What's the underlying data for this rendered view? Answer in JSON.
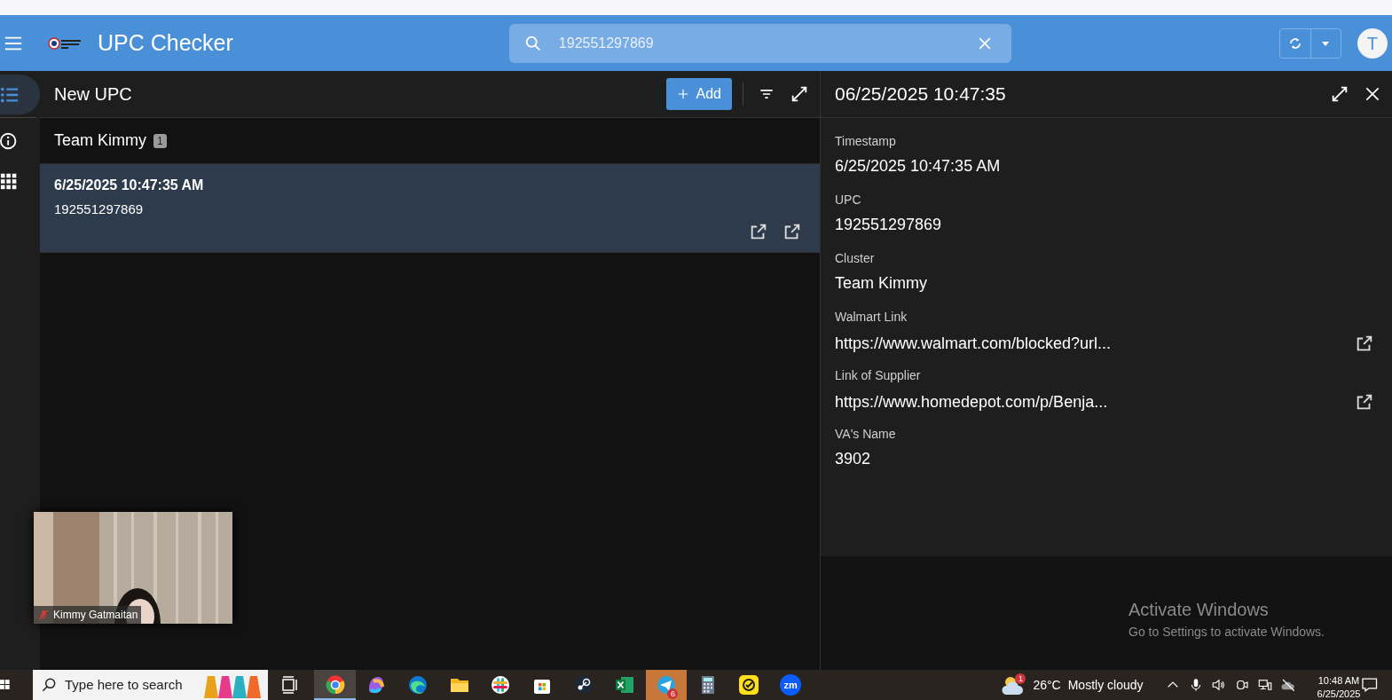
{
  "header": {
    "title": "UPC Checker",
    "search": {
      "value": "192551297869"
    },
    "avatar": "T"
  },
  "rail": [
    {
      "kind": "list",
      "selected": true
    },
    {
      "kind": "info",
      "selected": false
    },
    {
      "kind": "apps",
      "selected": false
    }
  ],
  "list_panel": {
    "title": "New UPC",
    "add_button": "Add",
    "groups": [
      {
        "name": "Team Kimmy",
        "count": "1",
        "items": [
          {
            "title": "6/25/2025 10:47:35 AM",
            "subtitle": "192551297869",
            "selected": true
          }
        ]
      }
    ]
  },
  "detail": {
    "title": "06/25/2025 10:47:35",
    "fields": [
      {
        "label": "Timestamp",
        "value": "6/25/2025 10:47:35 AM",
        "kind": "text"
      },
      {
        "label": "UPC",
        "value": "192551297869",
        "kind": "text"
      },
      {
        "label": "Cluster",
        "value": "Team Kimmy",
        "kind": "text"
      },
      {
        "label": "Walmart Link",
        "value": "https://www.walmart.com/blocked?url...",
        "kind": "link"
      },
      {
        "label": "Link of Supplier",
        "value": "https://www.homedepot.com/p/Benja...",
        "kind": "link"
      },
      {
        "label": "VA's Name",
        "value": "3902",
        "kind": "text"
      }
    ]
  },
  "video": {
    "name": "Kimmy Gatmaitan",
    "muted": true
  },
  "os_notice": {
    "title": "Activate Windows",
    "text": "Go to Settings to activate Windows."
  },
  "taskbar": {
    "search_placeholder": "Type here to search",
    "apps": [
      {
        "kind": "taskview",
        "selected": false,
        "flashing": false
      },
      {
        "kind": "browser",
        "selected": true,
        "flashing": false
      },
      {
        "kind": "swirl",
        "selected": false,
        "flashing": false
      },
      {
        "kind": "wave",
        "selected": false,
        "flashing": false
      },
      {
        "kind": "folder",
        "selected": false,
        "flashing": false
      },
      {
        "kind": "hash",
        "selected": false,
        "flashing": false
      },
      {
        "kind": "bag",
        "selected": false,
        "flashing": false
      },
      {
        "kind": "steam",
        "selected": false,
        "flashing": false
      },
      {
        "kind": "sheet",
        "selected": false,
        "flashing": false
      },
      {
        "kind": "plane",
        "selected": false,
        "flashing": true,
        "badge": "6"
      },
      {
        "kind": "calc",
        "selected": false,
        "flashing": false
      },
      {
        "kind": "check",
        "selected": false,
        "flashing": false
      },
      {
        "kind": "zm",
        "selected": false,
        "flashing": false,
        "label": "zm"
      }
    ],
    "weather_badge": "1",
    "temperature": "26°C",
    "weather": "Mostly cloudy",
    "time": "10:48 AM",
    "date": "6/25/2025"
  }
}
